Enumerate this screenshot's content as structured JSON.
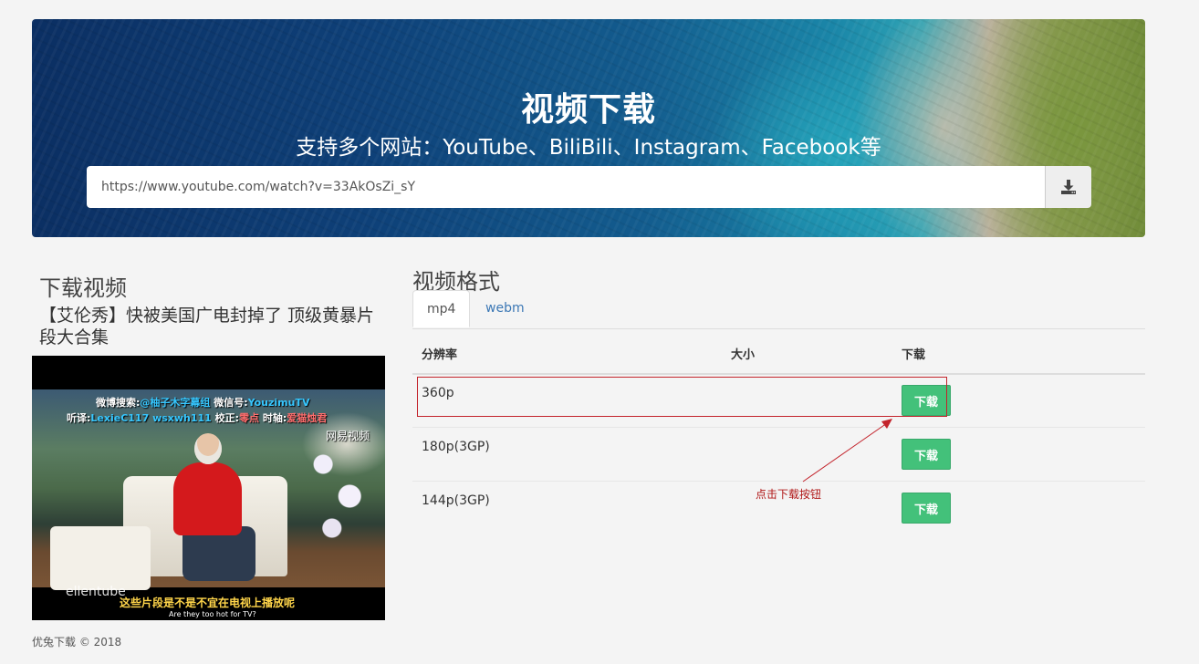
{
  "hero": {
    "title": "视频下载",
    "subtitle": "支持多个网站：YouTube、BiliBili、Instagram、Facebook等",
    "url_value": "https://www.youtube.com/watch?v=33AkOsZi_sY",
    "download_icon": "download-tray-icon"
  },
  "left": {
    "heading": "下载视频",
    "video_title": "【艾伦秀】快被美国广电封掉了 顶级黄暴片段大合集",
    "thumbnail": {
      "sub1_prefix": "微博搜索:",
      "sub1_highlight": "@柚子木字幕组",
      "sub1_mid": "  微信号:",
      "sub1_highlight2": "YouzimuTV",
      "watermark": "网易视频",
      "sub2_a": "听译:",
      "sub2_a_val": "LexieC117  wsxwh111",
      "sub2_b": "  校正:",
      "sub2_b_val": "零点",
      "sub2_c": "  时轴:",
      "sub2_c_val": "爱猫烛君",
      "logo": "ellentube",
      "bottom_sub": "这些片段是不是不宜在电视上播放呢",
      "bottom_sub_en": "Are they too hot for TV?"
    }
  },
  "footer": "优兔下载 © 2018",
  "right": {
    "heading": "视频格式",
    "tabs": [
      {
        "label": "mp4",
        "active": true
      },
      {
        "label": "webm",
        "active": false
      }
    ],
    "columns": {
      "resolution": "分辨率",
      "size": "大小",
      "download": "下载"
    },
    "rows": [
      {
        "resolution": "360p",
        "size": "",
        "button": "下载"
      },
      {
        "resolution": "180p(3GP)",
        "size": "",
        "button": "下载"
      },
      {
        "resolution": "144p(3GP)",
        "size": "",
        "button": "下载"
      }
    ],
    "annotation": "点击下载按钮"
  },
  "colors": {
    "accent_green": "#43c17a",
    "annotation_red": "#c3232b",
    "tab_link_blue": "#3c78b5"
  }
}
